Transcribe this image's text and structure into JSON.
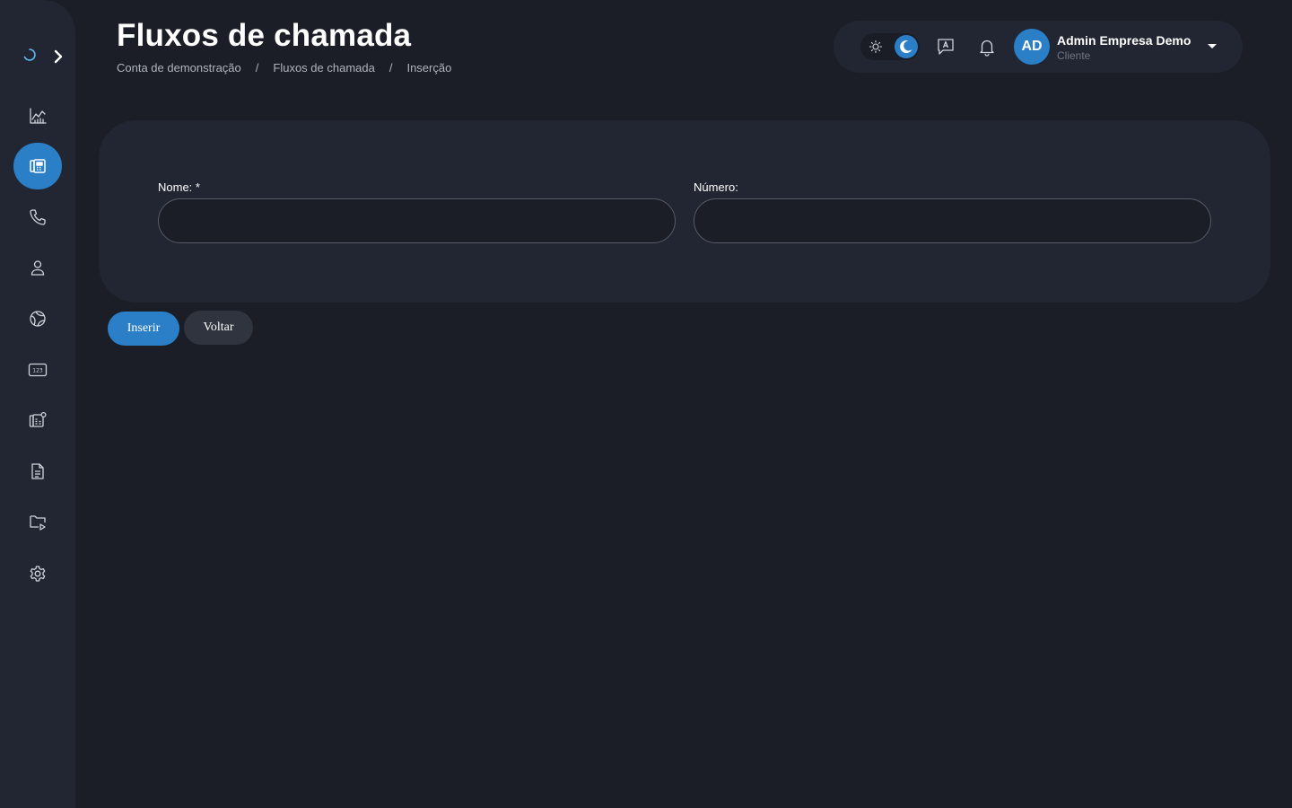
{
  "header": {
    "title": "Fluxos de chamada",
    "breadcrumb": [
      "Conta de demonstração",
      "Fluxos de chamada",
      "Inserção"
    ],
    "breadcrumb_separator": "/"
  },
  "topbar": {
    "theme_options": [
      "sun-icon",
      "moon-icon"
    ],
    "theme_selected": "dark",
    "icons": [
      "chat-icon",
      "bell-icon"
    ],
    "user": {
      "initials": "AD",
      "name": "Admin Empresa Demo",
      "role": "Cliente"
    }
  },
  "sidebar": {
    "items": [
      {
        "icon": "chart-icon",
        "active": false
      },
      {
        "icon": "call-flow-icon",
        "active": true
      },
      {
        "icon": "phone-icon",
        "active": false
      },
      {
        "icon": "user-icon",
        "active": false
      },
      {
        "icon": "globe-icon",
        "active": false
      },
      {
        "icon": "numbers-icon",
        "active": false
      },
      {
        "icon": "flow-settings-icon",
        "active": false
      },
      {
        "icon": "document-icon",
        "active": false
      },
      {
        "icon": "media-folder-icon",
        "active": false
      },
      {
        "icon": "gear-icon",
        "active": false
      }
    ]
  },
  "form": {
    "name_label": "Nome: *",
    "name_value": "",
    "number_label": "Número:",
    "number_value": ""
  },
  "actions": {
    "submit_label": "Inserir",
    "back_label": "Voltar"
  },
  "colors": {
    "accent": "#2a7fc7",
    "background": "#1b1e26",
    "panel": "#212632"
  }
}
